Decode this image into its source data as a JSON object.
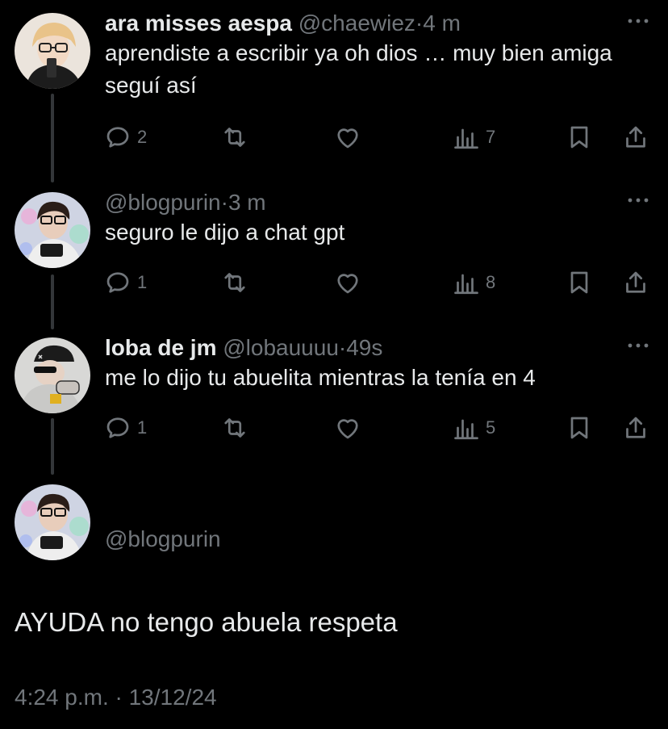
{
  "replies": [
    {
      "name": "ara misses aespa",
      "handle": "@chaewiez",
      "time": "4 m",
      "text": "aprendiste a escribir ya oh dios … muy bien amiga seguí así",
      "replies_count": "2",
      "views": "7"
    },
    {
      "name": "",
      "handle": "@blogpurin",
      "time": "3 m",
      "text": "seguro le dijo a chat gpt",
      "replies_count": "1",
      "views": "8"
    },
    {
      "name": "loba de jm",
      "handle": "@lobauuuu",
      "time": "49s",
      "text": "me lo dijo tu abuelita mientras la tenía en 4",
      "replies_count": "1",
      "views": "5"
    }
  ],
  "main_tweet": {
    "handle": "@blogpurin",
    "text": "AYUDA no tengo abuela respeta",
    "timestamp": "4:24 p.m. · 13/12/24"
  },
  "separator": "·",
  "icons": {
    "reply": "reply-icon",
    "retweet": "retweet-icon",
    "like": "heart-icon",
    "views": "views-icon",
    "bookmark": "bookmark-icon",
    "share": "share-icon",
    "more": "more-icon"
  },
  "colors": {
    "background": "#000000",
    "text": "#e7e9ea",
    "secondary": "#71767b",
    "thread_line": "#333639"
  }
}
